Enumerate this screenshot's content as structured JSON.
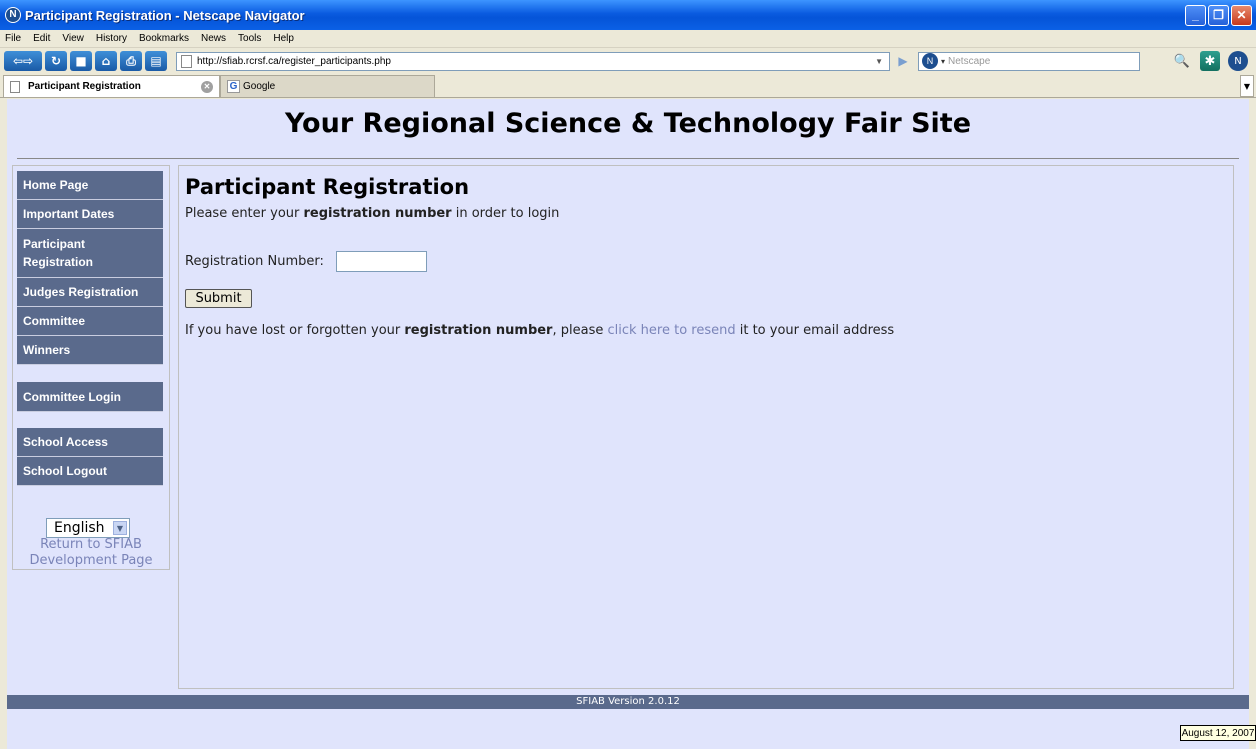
{
  "window": {
    "title": "Participant Registration - Netscape Navigator",
    "controls": {
      "minimize": "_",
      "maximize": "❐",
      "close": "✕"
    }
  },
  "menu": [
    "File",
    "Edit",
    "View",
    "History",
    "Bookmarks",
    "News",
    "Tools",
    "Help"
  ],
  "address": {
    "url": "http://sfiab.rcrsf.ca/register_participants.php",
    "search_placeholder": "Netscape"
  },
  "tabs": [
    {
      "label": "Participant Registration",
      "active": true
    },
    {
      "label": "Google",
      "active": false
    }
  ],
  "site": {
    "title": "Your Regional Science & Technology Fair Site"
  },
  "nav": {
    "group1": [
      "Home Page",
      "Important Dates",
      "Participant Registration",
      "Judges Registration",
      "Committee",
      "Winners"
    ],
    "group2": [
      "Committee Login"
    ],
    "group3": [
      "School Access",
      "School Logout"
    ],
    "language": "English",
    "return_link": "Return to SFIAB Development Page"
  },
  "main": {
    "heading": "Participant Registration",
    "intro_pre": "Please enter your ",
    "intro_bold": "registration number",
    "intro_post": " in order to login",
    "reg_label": "Registration Number:",
    "submit_label": "Submit",
    "lost_pre": "If you have lost or forgotten your ",
    "lost_bold": "registration number",
    "lost_mid": ", please ",
    "lost_link": "click here to resend",
    "lost_post": " it to your email address"
  },
  "footer": {
    "version": "SFIAB Version 2.0.12"
  },
  "date": "August 12, 2007",
  "colors": {
    "nav_bg": "#5a6a8c",
    "page_bg": "#E0E4FC",
    "link": "#7a84b8"
  }
}
